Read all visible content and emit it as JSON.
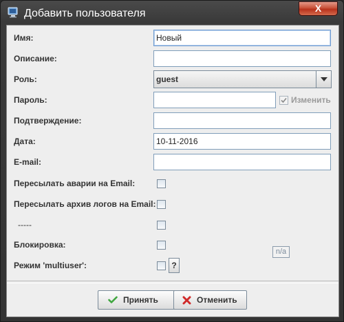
{
  "window": {
    "title": "Добавить пользователя",
    "close_label": "X"
  },
  "form": {
    "name": {
      "label": "Имя:",
      "value": "Новый"
    },
    "description": {
      "label": "Описание:",
      "value": ""
    },
    "role": {
      "label": "Роль:",
      "value": "guest"
    },
    "password": {
      "label": "Пароль:",
      "value": "",
      "change_label": "Изменить",
      "change_checked": true
    },
    "confirm": {
      "label": "Подтверждение:",
      "value": ""
    },
    "date": {
      "label": "Дата:",
      "value": "10-11-2016"
    },
    "email": {
      "label": "E-mail:",
      "value": ""
    },
    "forward_alarms": {
      "label": "Пересылать аварии на Email:",
      "checked": false
    },
    "forward_logs": {
      "label": "Пересылать архив логов на Email:",
      "checked": false
    },
    "dashes": {
      "label": "-----",
      "checked": false
    },
    "block": {
      "label": "Блокировка:",
      "checked": false
    },
    "multiuser": {
      "label": "Режим 'multiuser':",
      "checked": false,
      "help_label": "?"
    },
    "na_badge": "n/a"
  },
  "buttons": {
    "accept": "Принять",
    "cancel": "Отменить"
  },
  "colors": {
    "accept_icon": "#3fa63f",
    "cancel_icon": "#d02a2a",
    "close_button": "#c8452c"
  }
}
